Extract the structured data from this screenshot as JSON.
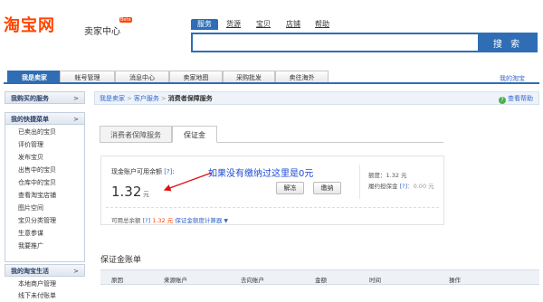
{
  "header": {
    "logo": "淘宝网",
    "subtitle": "卖家中心",
    "beta": "Beta",
    "search_tabs": [
      "服务",
      "货源",
      "宝贝",
      "店铺",
      "帮助"
    ],
    "search_placeholder": "",
    "search_button": "搜 索"
  },
  "nav": {
    "tabs": [
      "我是卖家",
      "帐号管理",
      "消息中心",
      "卖家地图",
      "采购批发",
      "卖往海外"
    ],
    "active_tab": "我是卖家",
    "right_link": "我的淘宝"
  },
  "sidebar": {
    "sections": [
      {
        "title": "我购买的服务",
        "arrow": ">"
      },
      {
        "title": "我的快捷菜单",
        "arrow": ">"
      },
      {
        "title": "我的淘宝生活",
        "arrow": ">"
      }
    ],
    "quick_items": [
      "已卖出的宝贝",
      "评价管理",
      "发布宝贝",
      "出售中的宝贝",
      "仓库中的宝贝",
      "查看淘宝店铺",
      "图片空间",
      "宝贝分类管理",
      "生意参谋",
      "我要推广"
    ],
    "life_items": [
      "本地商户管理",
      "线下未付账单"
    ]
  },
  "breadcrumb": {
    "items": [
      "我是卖家",
      "客户服务"
    ],
    "current": "消费者保障服务",
    "separator": ">",
    "help": "查看帮助"
  },
  "content_tabs": [
    "消费者保障服务",
    "保证金"
  ],
  "content_tab_active": "保证金",
  "deposit": {
    "available_label": "现金账户可用余额",
    "available_help": "[?]",
    "available_suffix": ":",
    "amount": "1.32",
    "amount_unit": "元",
    "buttons": [
      "解冻",
      "缴纳"
    ],
    "quota_label": "额度：",
    "quota_value": "1.32 元",
    "fulfill_label": "履约担保金",
    "fulfill_help": "[?]",
    "fulfill_value": "：0.00 元",
    "total_label": "可用总余额",
    "total_help": "[?]",
    "total_value": "1.32 元",
    "calculator": "保证金额度计算器",
    "caret": "▼"
  },
  "annotation": {
    "text": "如果没有缴纳过这里是0元",
    "color": "#1d4bd6"
  },
  "ledger": {
    "title": "保证金账单",
    "columns": [
      "原因",
      "来源账户",
      "去向账户",
      "金额",
      "时间",
      "操作"
    ]
  },
  "colors": {
    "brand": "#ff4400",
    "accent": "#2f6db5",
    "link": "#3366cc",
    "arrow": "#d11"
  }
}
